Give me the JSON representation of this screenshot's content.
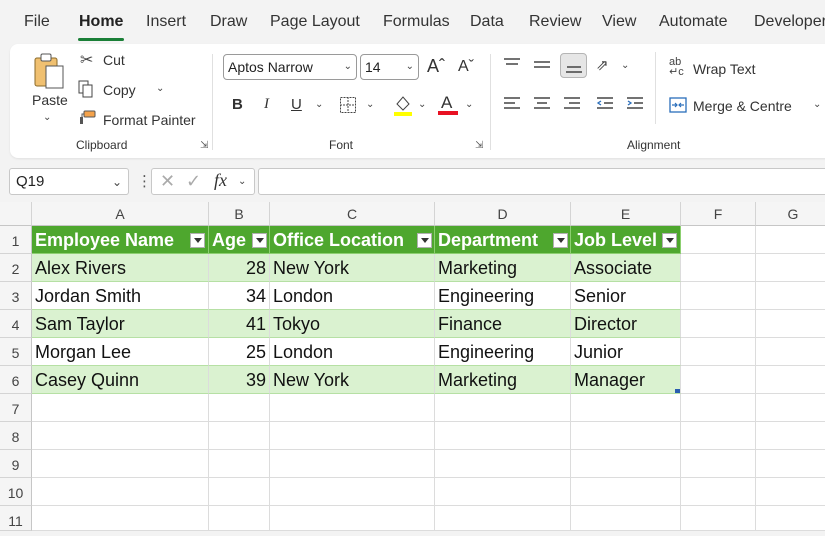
{
  "menu": [
    "File",
    "Home",
    "Insert",
    "Draw",
    "Page Layout",
    "Formulas",
    "Data",
    "Review",
    "View",
    "Automate",
    "Developer"
  ],
  "clipboard": {
    "paste": "Paste",
    "cut": "Cut",
    "copy": "Copy",
    "format_painter": "Format Painter",
    "label": "Clipboard"
  },
  "font": {
    "name": "Aptos Narrow",
    "size": "14",
    "bold": "B",
    "italic": "I",
    "underline": "U",
    "label": "Font",
    "highlight_color": "#ffff00",
    "font_color": "#e81123"
  },
  "alignment": {
    "wrap_text": "Wrap Text",
    "merge_centre": "Merge & Centre",
    "label": "Alignment"
  },
  "formula_bar": {
    "name_box": "Q19",
    "fx": "fx",
    "value": ""
  },
  "columns": [
    "A",
    "B",
    "C",
    "D",
    "E",
    "F",
    "G"
  ],
  "rows": [
    "1",
    "2",
    "3",
    "4",
    "5",
    "6",
    "7",
    "8",
    "9",
    "10",
    "11"
  ],
  "table": {
    "headers": [
      "Employee Name",
      "Age",
      "Office Location",
      "Department",
      "Job Level"
    ],
    "rows": [
      [
        "Alex Rivers",
        "28",
        "New York",
        "Marketing",
        "Associate"
      ],
      [
        "Jordan Smith",
        "34",
        "London",
        "Engineering",
        "Senior"
      ],
      [
        "Sam Taylor",
        "41",
        "Tokyo",
        "Finance",
        "Director"
      ],
      [
        "Morgan Lee",
        "25",
        "London",
        "Engineering",
        "Junior"
      ],
      [
        "Casey Quinn",
        "39",
        "New York",
        "Marketing",
        "Manager"
      ]
    ],
    "header_color": "#4ea72e",
    "band_color": "#daf2d0"
  }
}
